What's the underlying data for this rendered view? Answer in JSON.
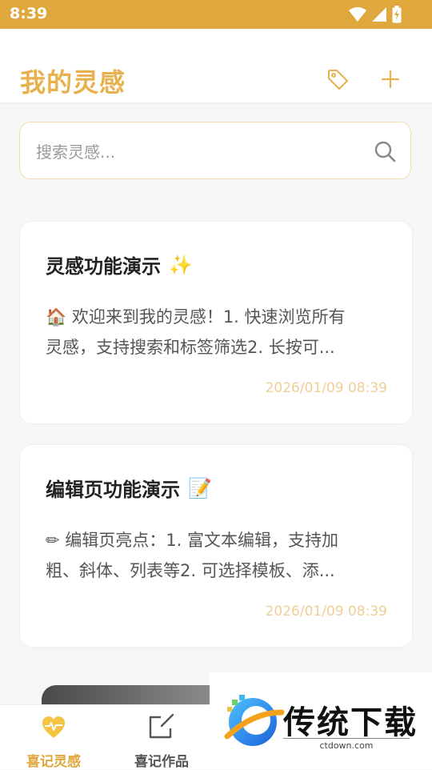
{
  "status": {
    "time": "8:39"
  },
  "header": {
    "title": "我的灵感"
  },
  "search": {
    "placeholder": "搜索灵感..."
  },
  "cards": [
    {
      "title": "灵感功能演示",
      "emoji": "✨",
      "line1": "🏠 欢迎来到我的灵感！1. 快速浏览所有",
      "line2": "灵感，支持搜索和标签筛选2. 长按可...",
      "date": "2026/01/09 08:39"
    },
    {
      "title": "编辑页功能演示",
      "emoji": "📝",
      "line1": "✏ 编辑页亮点：1. 富文本编辑，支持加",
      "line2": "粗、斜体、列表等2. 可选择模板、添...",
      "date": "2026/01/09 08:39"
    }
  ],
  "tabs": [
    {
      "label": "喜记灵感",
      "color": "#e0a73c"
    },
    {
      "label": "喜记作品",
      "color": "#555555"
    }
  ],
  "watermark": {
    "brand": "传统下载",
    "domain": "ctdown.com"
  },
  "colors": {
    "accent": "#e0a73c",
    "title": "#e7b14e",
    "date": "#f0cf97"
  }
}
